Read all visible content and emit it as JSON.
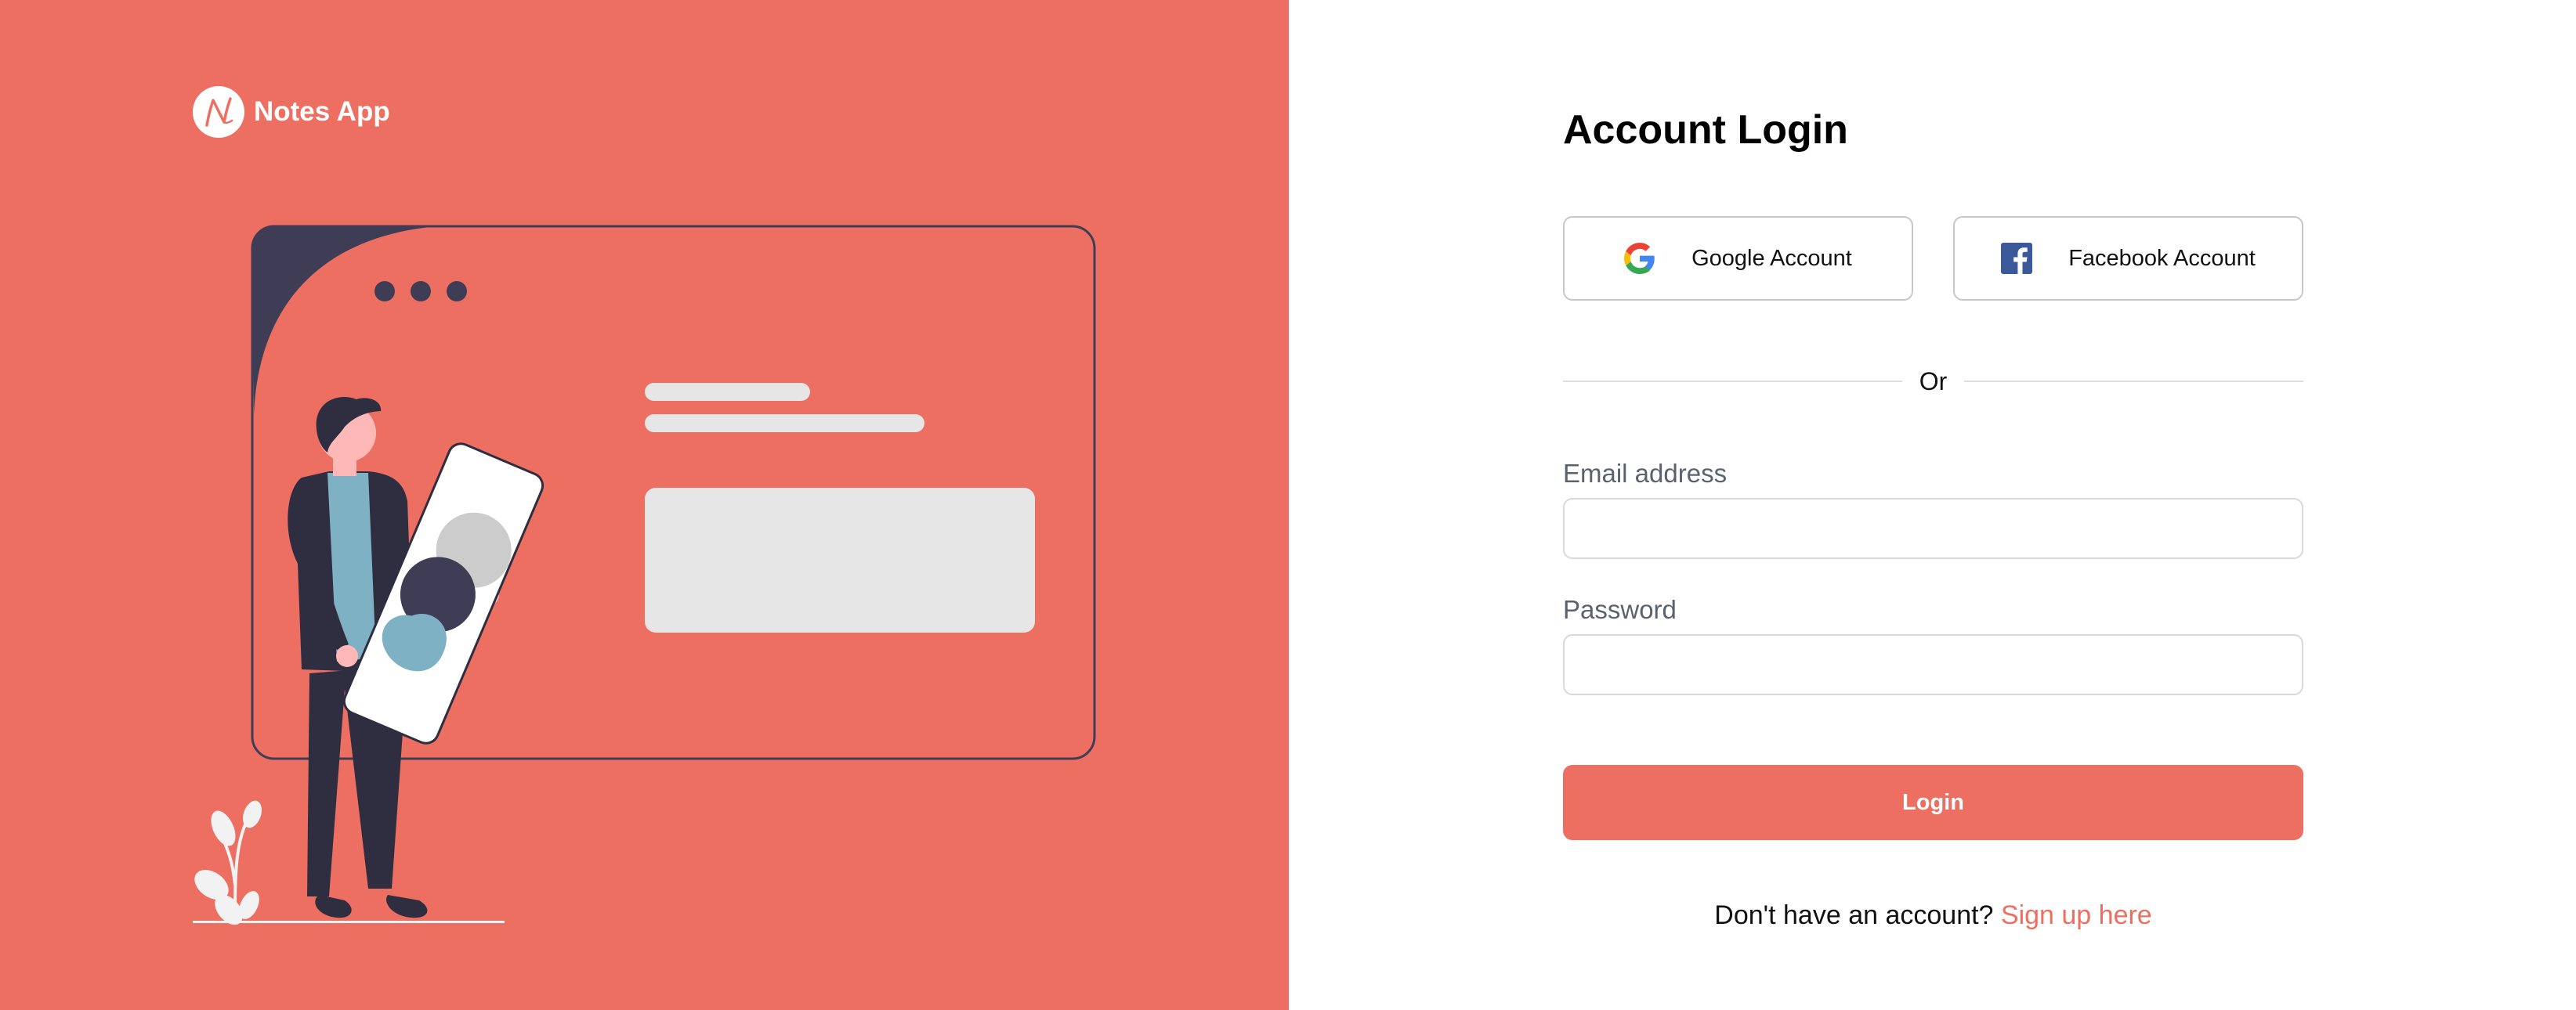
{
  "brand": {
    "name": "Notes App",
    "logo_letter": "N",
    "icon": "notes-app-logo-icon"
  },
  "colors": {
    "accent": "#ec6f61",
    "dark": "#2f2e41",
    "light_gray": "#e6e6e6",
    "teal": "#7eb1c3"
  },
  "login": {
    "title": "Account Login",
    "google_label": "Google Account",
    "facebook_label": "Facebook Account",
    "divider_text": "Or",
    "email_label": "Email address",
    "email_value": "",
    "password_label": "Password",
    "password_value": "",
    "submit_label": "Login",
    "signup_prompt": "Don't have an account?",
    "signup_link": "Sign up here"
  }
}
